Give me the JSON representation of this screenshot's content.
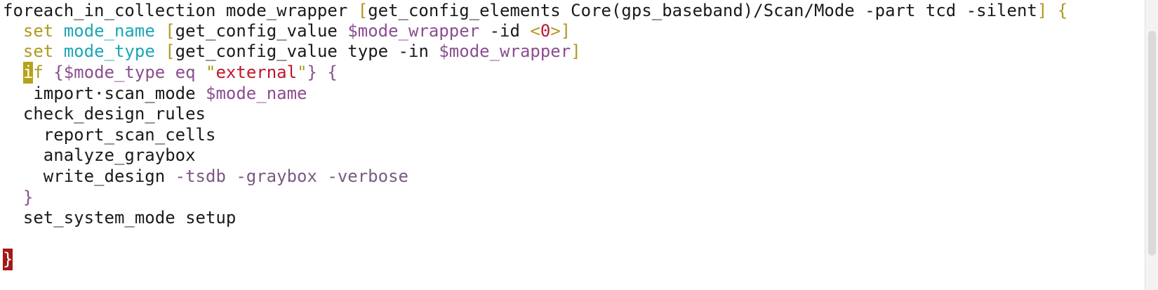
{
  "editor": {
    "colors": {
      "background": "#ffffff",
      "plain": "#1a1a1a",
      "keyword": "#b09a1e",
      "identifier": "#1ba6b5",
      "variable": "#8a4e8f",
      "string": "#c0162a",
      "cursor_highlight": "#b6a21a",
      "brace_match": "#a31818"
    },
    "lines": [
      {
        "tokens": [
          {
            "t": "foreach_in_collection mode_wrapper ",
            "c": "plain"
          },
          {
            "t": "[",
            "c": "bracket"
          },
          {
            "t": "get_config_elements Core(gps_baseband)/Scan/Mode -part tcd -silent",
            "c": "plain"
          },
          {
            "t": "]",
            "c": "bracket"
          },
          {
            "t": " {",
            "c": "bracket"
          }
        ]
      },
      {
        "tokens": [
          {
            "t": "  ",
            "c": "plain"
          },
          {
            "t": "set",
            "c": "keyword"
          },
          {
            "t": " ",
            "c": "plain"
          },
          {
            "t": "mode_name",
            "c": "identifier"
          },
          {
            "t": " ",
            "c": "plain"
          },
          {
            "t": "[",
            "c": "bracket"
          },
          {
            "t": "get_config_value ",
            "c": "plain"
          },
          {
            "t": "$mode_wrapper",
            "c": "variable"
          },
          {
            "t": " -id ",
            "c": "plain"
          },
          {
            "t": "<",
            "c": "bracket"
          },
          {
            "t": "0",
            "c": "number"
          },
          {
            "t": ">",
            "c": "bracket"
          },
          {
            "t": "]",
            "c": "bracket"
          }
        ]
      },
      {
        "tokens": [
          {
            "t": "  ",
            "c": "plain"
          },
          {
            "t": "set",
            "c": "keyword"
          },
          {
            "t": " ",
            "c": "plain"
          },
          {
            "t": "mode_type",
            "c": "identifier"
          },
          {
            "t": " ",
            "c": "plain"
          },
          {
            "t": "[",
            "c": "bracket"
          },
          {
            "t": "get_config_value type -in ",
            "c": "plain"
          },
          {
            "t": "$mode_wrapper",
            "c": "variable"
          },
          {
            "t": "]",
            "c": "bracket"
          }
        ]
      },
      {
        "tokens": [
          {
            "t": "  ",
            "c": "plain"
          },
          {
            "t": "i",
            "c": "cursor-yellow"
          },
          {
            "t": "f",
            "c": "keyword"
          },
          {
            "t": " {",
            "c": "variable"
          },
          {
            "t": "$mode_type",
            "c": "variable"
          },
          {
            "t": " eq ",
            "c": "variable"
          },
          {
            "t": "\"",
            "c": "bracket"
          },
          {
            "t": "external",
            "c": "string"
          },
          {
            "t": "\"",
            "c": "bracket"
          },
          {
            "t": "} {",
            "c": "variable"
          }
        ]
      },
      {
        "tokens": [
          {
            "t": "   import",
            "c": "plain"
          },
          {
            "t": "·",
            "c": "ws"
          },
          {
            "t": "scan_mode ",
            "c": "plain"
          },
          {
            "t": "$mode_name",
            "c": "variable"
          }
        ]
      },
      {
        "tokens": [
          {
            "t": "  check_design_rules",
            "c": "plain"
          }
        ]
      },
      {
        "tokens": [
          {
            "t": "    report_scan_cells",
            "c": "plain"
          }
        ]
      },
      {
        "tokens": [
          {
            "t": "    analyze_graybox",
            "c": "plain"
          }
        ]
      },
      {
        "tokens": [
          {
            "t": "    write_design ",
            "c": "plain"
          },
          {
            "t": "-tsdb -graybox -verbose",
            "c": "option"
          }
        ]
      },
      {
        "tokens": [
          {
            "t": "  ",
            "c": "plain"
          },
          {
            "t": "}",
            "c": "variable"
          }
        ]
      },
      {
        "tokens": [
          {
            "t": "  set_system_mode setup",
            "c": "plain"
          }
        ]
      },
      {
        "tokens": []
      },
      {
        "tokens": [
          {
            "t": "}",
            "c": "cursor-red"
          }
        ]
      }
    ]
  }
}
